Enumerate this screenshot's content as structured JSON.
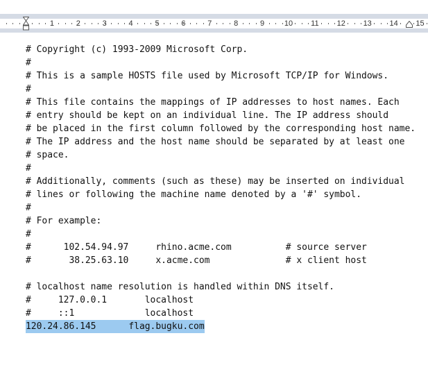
{
  "ruler": {
    "labels": [
      "1",
      "2",
      "3",
      "4",
      "5",
      "6",
      "7",
      "8",
      "9",
      "10",
      "11",
      "12",
      "13",
      "14",
      "15"
    ]
  },
  "document": {
    "lines": [
      "# Copyright (c) 1993-2009 Microsoft Corp.",
      "#",
      "# This is a sample HOSTS file used by Microsoft TCP/IP for Windows.",
      "#",
      "# This file contains the mappings of IP addresses to host names. Each",
      "# entry should be kept on an individual line. The IP address should",
      "# be placed in the first column followed by the corresponding host name.",
      "# The IP address and the host name should be separated by at least one",
      "# space.",
      "#",
      "# Additionally, comments (such as these) may be inserted on individual",
      "# lines or following the machine name denoted by a '#' symbol.",
      "#",
      "# For example:",
      "#",
      "#      102.54.94.97     rhino.acme.com          # source server",
      "#       38.25.63.10     x.acme.com              # x client host",
      "",
      "# localhost name resolution is handled within DNS itself.",
      "#     127.0.0.1       localhost",
      "#     ::1             localhost"
    ],
    "selected_line": "120.24.86.145      flag.bugku.com"
  },
  "colors": {
    "selection": "#9ccaf0",
    "ruler": "#d5dbe5"
  }
}
